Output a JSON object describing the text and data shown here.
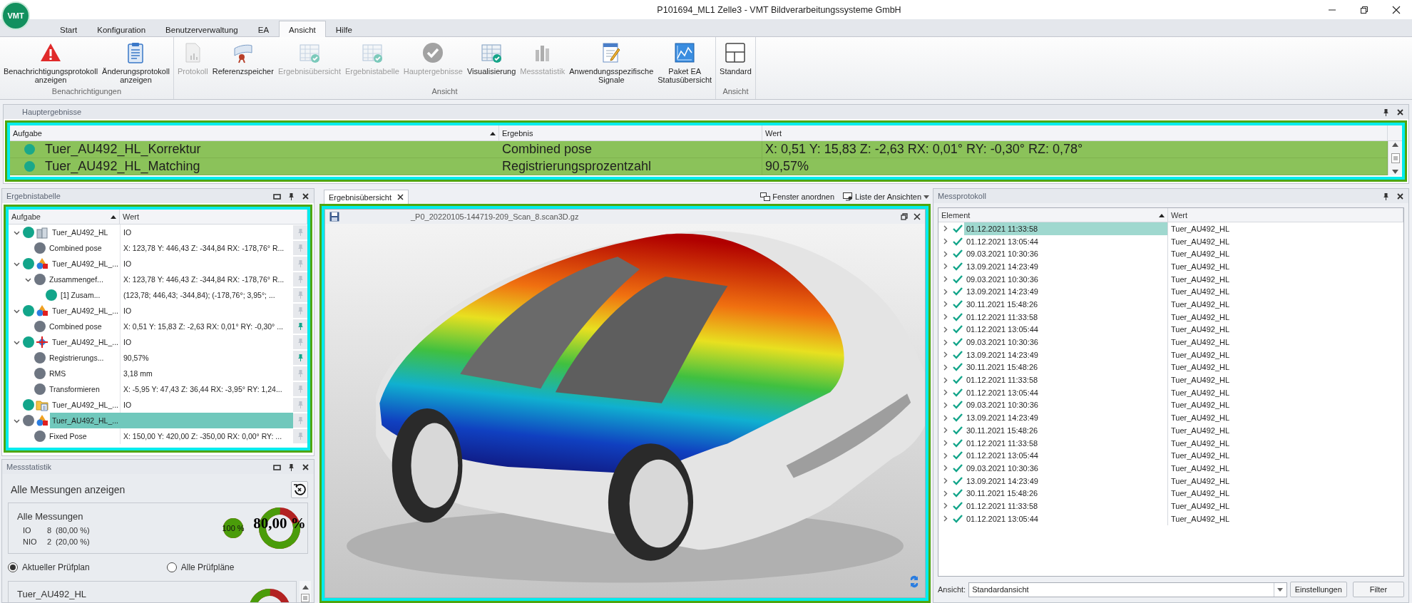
{
  "window": {
    "logo": "VMT",
    "title": "P101694_ML1 Zelle3 - VMT Bildverarbeitungssysteme GmbH"
  },
  "menu_tabs": [
    {
      "label": "Start",
      "selected": false
    },
    {
      "label": "Konfiguration",
      "selected": false
    },
    {
      "label": "Benutzerverwaltung",
      "selected": false
    },
    {
      "label": "EA",
      "selected": false
    },
    {
      "label": "Ansicht",
      "selected": true
    },
    {
      "label": "Hilfe",
      "selected": false
    }
  ],
  "ribbon": {
    "groups": [
      {
        "label": "Benachrichtigungen",
        "buttons": [
          {
            "label": "Benachrichtigungsprotokoll\nanzeigen",
            "kind": "warning",
            "disabled": false
          },
          {
            "label": "Änderungsprotokoll\nanzeigen",
            "kind": "clipboard",
            "disabled": false
          }
        ]
      },
      {
        "label": "Ansicht",
        "buttons": [
          {
            "label": "Protokoll",
            "kind": "document",
            "disabled": true
          },
          {
            "label": "Referenzspeicher",
            "kind": "scroll",
            "disabled": false
          },
          {
            "label": "Ergebnisübersicht",
            "kind": "grid",
            "disabled": true
          },
          {
            "label": "Ergebnistabelle",
            "kind": "grid",
            "disabled": true
          },
          {
            "label": "Hauptergebnisse",
            "kind": "check",
            "disabled": true
          },
          {
            "label": "Visualisierung",
            "kind": "grid",
            "disabled": false
          },
          {
            "label": "Messstatistik",
            "kind": "bars",
            "disabled": true
          },
          {
            "label": "Anwendungsspezifische\nSignale",
            "kind": "pencil",
            "disabled": false
          },
          {
            "label": "Paket EA\nStatusübersicht",
            "kind": "chart",
            "disabled": false
          }
        ]
      },
      {
        "label": "Ansicht",
        "buttons": [
          {
            "label": "Standard",
            "kind": "layout",
            "disabled": false
          }
        ]
      }
    ]
  },
  "main_results": {
    "title": "Hauptergebnisse",
    "columns": [
      "Aufgabe",
      "Ergebnis",
      "Wert"
    ],
    "rows": [
      {
        "task": "Tuer_AU492_HL_Korrektur",
        "result": "Combined pose",
        "value": "X: 0,51 Y: 15,83 Z: -2,63 RX: 0,01° RY: -0,30° RZ: 0,78°"
      },
      {
        "task": "Tuer_AU492_HL_Matching",
        "result": "Registrierungsprozentzahl",
        "value": "90,57%"
      }
    ]
  },
  "result_table": {
    "title": "Ergebnistabelle",
    "columns": [
      "Aufgabe",
      "Wert"
    ],
    "rows": [
      {
        "task": "Tuer_AU492_HL",
        "value": "IO",
        "color": "#12a58a",
        "kind": "parts",
        "expanded": true,
        "selected": false,
        "pinned": false,
        "children": [
          {
            "task": "Combined pose",
            "value": "X: 123,78 Y: 446,43 Z: -344,84 RX: -178,76° R...",
            "color": "#6e7682",
            "selected": false,
            "pinned": false
          }
        ]
      },
      {
        "task": "Tuer_AU492_HL_...",
        "value": "IO",
        "color": "#12a58a",
        "kind": "shapes",
        "expanded": true,
        "selected": false,
        "pinned": false,
        "children": [
          {
            "task": "Zusammengef...",
            "value": "X: 123,78 Y: 446,43 Z: -344,84 RX: -178,76° R...",
            "color": "#6e7682",
            "expanded": true,
            "selected": false,
            "pinned": false,
            "children": [
              {
                "task": "[1] Zusam...",
                "value": "(123,78; 446,43; -344,84); (-178,76°; 3,95°; ...",
                "color": "#12a58a",
                "selected": false,
                "pinned": false
              }
            ]
          }
        ]
      },
      {
        "task": "Tuer_AU492_HL_...",
        "value": "IO",
        "color": "#12a58a",
        "kind": "shapes",
        "expanded": true,
        "selected": false,
        "pinned": false,
        "children": [
          {
            "task": "Combined pose",
            "value": "X: 0,51 Y: 15,83 Z: -2,63 RX: 0,01° RY: -0,30° ...",
            "color": "#6e7682",
            "selected": false,
            "pinned": true
          }
        ]
      },
      {
        "task": "Tuer_AU492_HL_...",
        "value": "IO",
        "color": "#12a58a",
        "kind": "target",
        "expanded": true,
        "selected": false,
        "pinned": false,
        "children": [
          {
            "task": "Registrierungs...",
            "value": "90,57%",
            "color": "#6e7682",
            "selected": false,
            "pinned": true
          },
          {
            "task": "RMS",
            "value": "3,18 mm",
            "color": "#6e7682",
            "selected": false,
            "pinned": false
          },
          {
            "task": "Transformieren",
            "value": "X: -5,95 Y: 47,43 Z: 36,44 RX: -3,95° RY: 1,24...",
            "color": "#6e7682",
            "selected": false,
            "pinned": false
          }
        ]
      },
      {
        "task": "Tuer_AU492_HL_...",
        "value": "IO",
        "color": "#12a58a",
        "kind": "folder",
        "selected": false,
        "pinned": false
      },
      {
        "task": "Tuer_AU492_HL_...",
        "color": "#6e7682",
        "kind": "shapes",
        "expanded": true,
        "selected": true,
        "pinned": false,
        "children": [
          {
            "task": "Fixed Pose",
            "value": "X: 150,00 Y: 420,00 Z: -350,00 RX: 0,00° RY: ...",
            "color": "#6e7682",
            "selected": false,
            "pinned": false
          }
        ]
      }
    ]
  },
  "stats": {
    "title": "Messstatistik",
    "heading": "Alle Messungen anzeigen",
    "summary": {
      "title": "Alle Messungen",
      "rows": [
        {
          "label": "IO",
          "count": "8",
          "share": "(80,00 %)"
        },
        {
          "label": "NIO",
          "count": "2",
          "share": "(20,00 %)"
        }
      ],
      "pie": {
        "label": "100 %"
      },
      "donut": {
        "label": "80,00 %"
      }
    },
    "scope": [
      {
        "label": "Aktueller Prüfplan",
        "selected": true
      },
      {
        "label": "Alle Prüfpläne",
        "selected": false
      }
    ],
    "plan": {
      "title": "Tuer_AU492_HL"
    }
  },
  "viewer": {
    "tab": "Ergebnisübersicht",
    "tools": [
      "Fenster anordnen",
      "Liste der Ansichten"
    ],
    "file_title": "_P0_20220105-144719-209_Scan_8.scan3D.gz",
    "picture": {
      "kind": "picture"
    }
  },
  "log": {
    "title": "Messprotokoll",
    "columns": [
      "Element",
      "Wert"
    ],
    "rows": [
      {
        "time": "01.12.2021 11:33:58",
        "value": "Tuer_AU492_HL",
        "expanded": false,
        "selected": true
      },
      {
        "time": "01.12.2021 13:05:44",
        "value": "Tuer_AU492_HL",
        "expanded": false,
        "selected": false
      },
      {
        "time": "09.03.2021 10:30:36",
        "value": "Tuer_AU492_HL",
        "expanded": false,
        "selected": false
      },
      {
        "time": "13.09.2021 14:23:49",
        "value": "Tuer_AU492_HL",
        "expanded": false,
        "selected": false
      },
      {
        "time": "09.03.2021 10:30:36",
        "value": "Tuer_AU492_HL",
        "expanded": false,
        "selected": false
      },
      {
        "time": "13.09.2021 14:23:49",
        "value": "Tuer_AU492_HL",
        "expanded": false,
        "selected": false
      },
      {
        "time": "30.11.2021 15:48:26",
        "value": "Tuer_AU492_HL",
        "expanded": false,
        "selected": false
      },
      {
        "time": "01.12.2021 11:33:58",
        "value": "Tuer_AU492_HL",
        "expanded": false,
        "selected": false
      },
      {
        "time": "01.12.2021 13:05:44",
        "value": "Tuer_AU492_HL",
        "expanded": false,
        "selected": false
      },
      {
        "time": "09.03.2021 10:30:36",
        "value": "Tuer_AU492_HL",
        "expanded": false,
        "selected": false
      },
      {
        "time": "13.09.2021 14:23:49",
        "value": "Tuer_AU492_HL",
        "expanded": false,
        "selected": false
      },
      {
        "time": "30.11.2021 15:48:26",
        "value": "Tuer_AU492_HL",
        "expanded": false,
        "selected": false
      },
      {
        "time": "01.12.2021 11:33:58",
        "value": "Tuer_AU492_HL",
        "expanded": false,
        "selected": false
      },
      {
        "time": "01.12.2021 13:05:44",
        "value": "Tuer_AU492_HL",
        "expanded": false,
        "selected": false
      },
      {
        "time": "09.03.2021 10:30:36",
        "value": "Tuer_AU492_HL",
        "expanded": false,
        "selected": false
      },
      {
        "time": "13.09.2021 14:23:49",
        "value": "Tuer_AU492_HL",
        "expanded": false,
        "selected": false
      },
      {
        "time": "30.11.2021 15:48:26",
        "value": "Tuer_AU492_HL",
        "expanded": false,
        "selected": false
      },
      {
        "time": "01.12.2021 11:33:58",
        "value": "Tuer_AU492_HL",
        "expanded": false,
        "selected": false
      },
      {
        "time": "01.12.2021 13:05:44",
        "value": "Tuer_AU492_HL",
        "expanded": false,
        "selected": false
      },
      {
        "time": "09.03.2021 10:30:36",
        "value": "Tuer_AU492_HL",
        "expanded": false,
        "selected": false
      },
      {
        "time": "13.09.2021 14:23:49",
        "value": "Tuer_AU492_HL",
        "expanded": false,
        "selected": false
      },
      {
        "time": "30.11.2021 15:48:26",
        "value": "Tuer_AU492_HL",
        "expanded": false,
        "selected": false
      },
      {
        "time": "01.12.2021 11:33:58",
        "value": "Tuer_AU492_HL",
        "expanded": false,
        "selected": false
      },
      {
        "time": "01.12.2021 13:05:44",
        "value": "Tuer_AU492_HL",
        "expanded": false,
        "selected": false
      }
    ],
    "view_label": "Ansicht:",
    "view_value": "Standardansicht",
    "buttons": [
      "Einstellungen",
      "Filter"
    ]
  }
}
